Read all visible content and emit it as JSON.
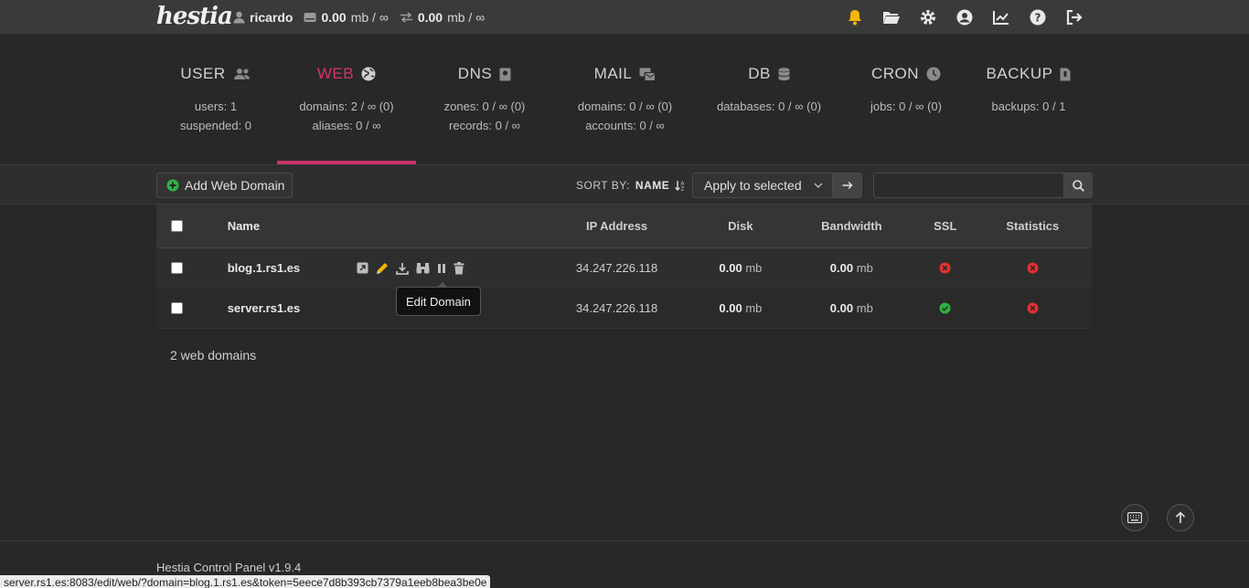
{
  "topbar": {
    "logo_text": "hestia",
    "username": "ricardo",
    "disk_value": "0.00",
    "disk_unit": "mb / ∞",
    "bw_value": "0.00",
    "bw_unit": "mb / ∞",
    "icons": [
      "bell-icon",
      "folder-icon",
      "gear-icon",
      "user-circle-icon",
      "chart-icon",
      "help-icon",
      "logout-icon"
    ]
  },
  "stats": [
    {
      "title": "USER",
      "icon": "users-icon",
      "lines": [
        "users: 1",
        "suspended: 0"
      ]
    },
    {
      "title": "WEB",
      "icon": "globe-icon",
      "lines": [
        "domains: 2 / ∞ (0)",
        "aliases: 0 / ∞"
      ]
    },
    {
      "title": "DNS",
      "icon": "book-icon",
      "lines": [
        "zones: 0 / ∞ (0)",
        "records: 0 / ∞"
      ]
    },
    {
      "title": "MAIL",
      "icon": "mail-icon",
      "lines": [
        "domains: 0 / ∞ (0)",
        "accounts: 0 / ∞"
      ]
    },
    {
      "title": "DB",
      "icon": "database-icon",
      "lines": [
        "databases: 0 / ∞ (0)"
      ]
    },
    {
      "title": "CRON",
      "icon": "clock-icon",
      "lines": [
        "jobs: 0 / ∞ (0)"
      ]
    },
    {
      "title": "BACKUP",
      "icon": "file-icon",
      "lines": [
        "backups: 0 / 1"
      ]
    }
  ],
  "toolbar": {
    "add_label": "Add Web Domain",
    "sort_label": "SORT BY:",
    "sort_value": "NAME",
    "apply_label": "Apply to selected",
    "search_placeholder": ""
  },
  "table": {
    "headers": {
      "name": "Name",
      "ip": "IP Address",
      "disk": "Disk",
      "bandwidth": "Bandwidth",
      "ssl": "SSL",
      "statistics": "Statistics"
    },
    "rows": [
      {
        "name": "blog.1.rs1.es",
        "ip": "34.247.226.118",
        "disk": "0.00",
        "disk_unit": "mb",
        "bw": "0.00",
        "bw_unit": "mb",
        "ssl": "disabled",
        "stats": "disabled"
      },
      {
        "name": "server.rs1.es",
        "ip": "34.247.226.118",
        "disk": "0.00",
        "disk_unit": "mb",
        "bw": "0.00",
        "bw_unit": "mb",
        "ssl": "enabled",
        "stats": "disabled"
      }
    ]
  },
  "tooltip": "Edit Domain",
  "count_label": "2 web domains",
  "footer": "Hestia Control Panel v1.9.4",
  "status_url": "server.rs1.es:8083/edit/web/?domain=blog.1.rs1.es&token=5eece7d8b393cb7379a1eeb8bea3be0e",
  "colors": {
    "accent": "#d6336c",
    "ok": "#2fb344",
    "error": "#e03131",
    "bell": "#f2b705"
  }
}
